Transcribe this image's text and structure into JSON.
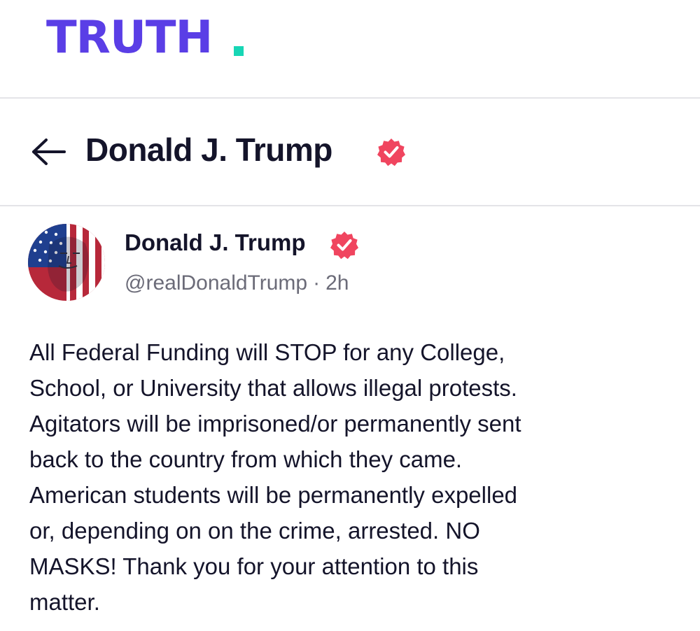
{
  "brand": {
    "logo_text": "TRUTH",
    "logo_color": "#5a3ee6",
    "logo_dot_color": "#17d6b5"
  },
  "header": {
    "back_icon": "arrow-left-icon",
    "title": "Donald J. Trump",
    "verified_icon": "verified-badge-icon",
    "badge_color": "#f0455f"
  },
  "post": {
    "avatar": "flag-portrait-avatar",
    "author_name": "Donald J. Trump",
    "verified_icon": "verified-badge-icon",
    "handle": "@realDonaldTrump",
    "separator": "·",
    "time": "2h",
    "text_lines": [
      "All Federal Funding will STOP for any College,",
      "School, or University that allows illegal protests.",
      "Agitators will be imprisoned/or permanently sent",
      "back to the country from which they came.",
      "American students will be permanently expelled",
      "or, depending on on the crime, arrested. NO",
      "MASKS! Thank you for your attention to this",
      "matter."
    ]
  }
}
